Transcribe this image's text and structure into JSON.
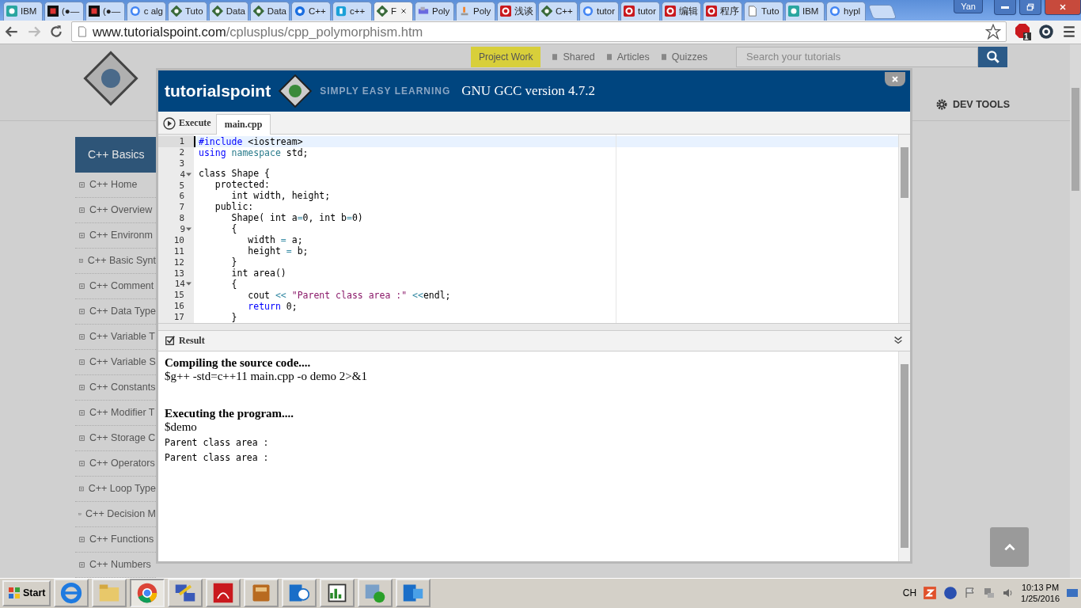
{
  "browser": {
    "tabs": [
      {
        "title": "IBM",
        "selected": false
      },
      {
        "title": "(●—",
        "selected": false
      },
      {
        "title": "(●—",
        "selected": false
      },
      {
        "title": "c alg",
        "selected": false
      },
      {
        "title": "Tuto",
        "selected": false
      },
      {
        "title": "Data",
        "selected": false
      },
      {
        "title": "Data",
        "selected": false
      },
      {
        "title": "C++",
        "selected": false
      },
      {
        "title": "c++",
        "selected": false
      },
      {
        "title": "F",
        "selected": true
      },
      {
        "title": "Poly",
        "selected": false
      },
      {
        "title": "Poly",
        "selected": false
      },
      {
        "title": "浅谈",
        "selected": false
      },
      {
        "title": "C++",
        "selected": false
      },
      {
        "title": "tutor",
        "selected": false
      },
      {
        "title": "tutor",
        "selected": false
      },
      {
        "title": "编辑",
        "selected": false
      },
      {
        "title": "程序",
        "selected": false
      },
      {
        "title": "Tuto",
        "selected": false
      },
      {
        "title": "IBM",
        "selected": false
      },
      {
        "title": "hypl",
        "selected": false
      }
    ],
    "profile": "Yan",
    "url_host": "www.tutorialspoint.com",
    "url_path": "/cplusplus/cpp_polymorphism.htm",
    "extension_badge": "1"
  },
  "page": {
    "nav": [
      {
        "label": "Project Work",
        "kind": "button"
      },
      {
        "label": "Shared",
        "kind": "link"
      },
      {
        "label": "Articles",
        "kind": "link"
      },
      {
        "label": "Quizzes",
        "kind": "link"
      }
    ],
    "search_placeholder": "Search your tutorials",
    "dev_tools": "DEV TOOLS",
    "sidebar": {
      "heading": "C++ Basics",
      "items": [
        "C++ Home",
        "C++ Overview",
        "C++ Environm",
        "C++ Basic Synt",
        "C++ Comment",
        "C++ Data Type",
        "C++ Variable T",
        "C++ Variable S",
        "C++ Constants",
        "C++ Modifier T",
        "C++ Storage C",
        "C++ Operators",
        "C++ Loop Type",
        "C++ Decision M",
        "C++ Functions",
        "C++ Numbers"
      ]
    }
  },
  "compiler": {
    "brand": "tutorialspoint",
    "tagline": "SIMPLY EASY LEARNING",
    "version": "GNU GCC version 4.7.2",
    "execute": "Execute",
    "file_tabs": [
      {
        "label": "main.cpp",
        "selected": true
      }
    ],
    "code": [
      {
        "number": "1",
        "foldable": false,
        "active": true,
        "tokens": [
          {
            "kind": "keyword",
            "text": "#include"
          },
          {
            "kind": "plain",
            "text": " <iostream>"
          }
        ]
      },
      {
        "number": "2",
        "foldable": false,
        "active": false,
        "tokens": [
          {
            "kind": "keyword",
            "text": "using"
          },
          {
            "kind": "type",
            "text": " namespace"
          },
          {
            "kind": "plain",
            "text": " std;"
          }
        ]
      },
      {
        "number": "3",
        "foldable": false,
        "active": false
      },
      {
        "number": "4",
        "foldable": true,
        "active": false,
        "tokens": [
          {
            "kind": "plain",
            "text": "class Shape {"
          }
        ]
      },
      {
        "number": "5",
        "foldable": false,
        "active": false,
        "tokens": [
          {
            "kind": "plain",
            "text": "   protected:"
          }
        ]
      },
      {
        "number": "6",
        "foldable": false,
        "active": false,
        "tokens": [
          {
            "kind": "plain",
            "text": "      int width, height;"
          }
        ]
      },
      {
        "number": "7",
        "foldable": false,
        "active": false,
        "tokens": [
          {
            "kind": "plain",
            "text": "   public:"
          }
        ]
      },
      {
        "number": "8",
        "foldable": false,
        "active": false,
        "tokens": [
          {
            "kind": "plain",
            "text": "      Shape( int a"
          },
          {
            "kind": "operator",
            "text": "="
          },
          {
            "kind": "plain",
            "text": "0, int b"
          },
          {
            "kind": "operator",
            "text": "="
          },
          {
            "kind": "plain",
            "text": "0)"
          }
        ]
      },
      {
        "number": "9",
        "foldable": true,
        "active": false,
        "tokens": [
          {
            "kind": "plain",
            "text": "      {"
          }
        ]
      },
      {
        "number": "10",
        "foldable": false,
        "active": false,
        "tokens": [
          {
            "kind": "plain",
            "text": "         width "
          },
          {
            "kind": "operator",
            "text": "="
          },
          {
            "kind": "plain",
            "text": " a;"
          }
        ]
      },
      {
        "number": "11",
        "foldable": false,
        "active": false,
        "tokens": [
          {
            "kind": "plain",
            "text": "         height "
          },
          {
            "kind": "operator",
            "text": "="
          },
          {
            "kind": "plain",
            "text": " b;"
          }
        ]
      },
      {
        "number": "12",
        "foldable": false,
        "active": false,
        "tokens": [
          {
            "kind": "plain",
            "text": "      }"
          }
        ]
      },
      {
        "number": "13",
        "foldable": false,
        "active": false,
        "tokens": [
          {
            "kind": "plain",
            "text": "      int area()"
          }
        ]
      },
      {
        "number": "14",
        "foldable": true,
        "active": false,
        "tokens": [
          {
            "kind": "plain",
            "text": "      {"
          }
        ]
      },
      {
        "number": "15",
        "foldable": false,
        "active": false,
        "tokens": [
          {
            "kind": "plain",
            "text": "         cout "
          },
          {
            "kind": "operator",
            "text": "<<"
          },
          {
            "kind": "string",
            "text": " \"Parent class area :\""
          },
          {
            "kind": "operator",
            "text": " <<"
          },
          {
            "kind": "plain",
            "text": "endl;"
          }
        ]
      },
      {
        "number": "16",
        "foldable": false,
        "active": false,
        "tokens": [
          {
            "kind": "keyword",
            "text": "         return"
          },
          {
            "kind": "plain",
            "text": " 0;"
          }
        ]
      },
      {
        "number": "17",
        "foldable": false,
        "active": false,
        "tokens": [
          {
            "kind": "plain",
            "text": "      }"
          }
        ]
      }
    ],
    "result_title": "Result",
    "result": [
      {
        "kind": "heading",
        "text": "Compiling the source code...."
      },
      {
        "kind": "command",
        "text": "$g++ -std=c++11 main.cpp -o demo 2>&1"
      },
      {
        "kind": "gap"
      },
      {
        "kind": "heading",
        "text": "Executing the program...."
      },
      {
        "kind": "command",
        "text": "$demo"
      },
      {
        "kind": "output",
        "text": "Parent class area :"
      },
      {
        "kind": "output",
        "text": "Parent class area :"
      }
    ]
  },
  "taskbar": {
    "start": "Start",
    "apps": [
      {
        "active": false
      },
      {
        "active": false
      },
      {
        "active": true
      },
      {
        "active": false
      },
      {
        "active": false
      },
      {
        "active": false
      },
      {
        "active": false
      },
      {
        "active": false
      },
      {
        "active": false
      },
      {
        "active": false
      }
    ],
    "language": "CH",
    "time": "10:13 PM",
    "date": "1/25/2016"
  }
}
